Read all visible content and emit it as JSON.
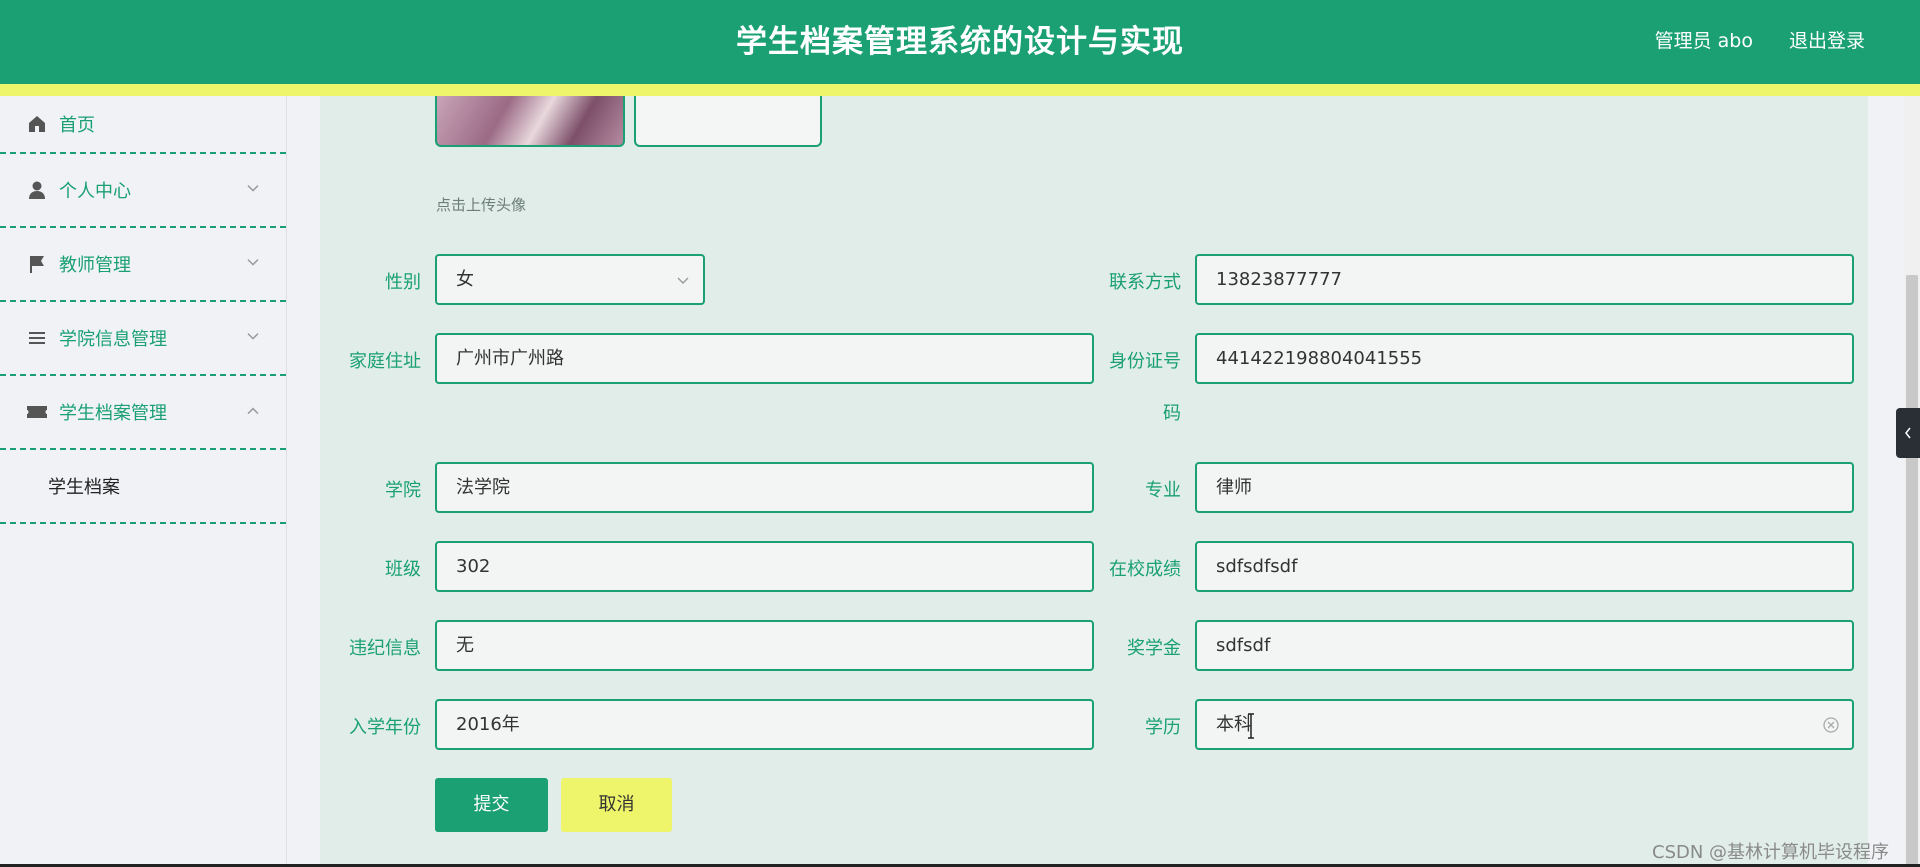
{
  "header": {
    "title": "学生档案管理系统的设计与实现",
    "user_label": "管理员 abo",
    "logout_label": "退出登录"
  },
  "sidebar": {
    "items": [
      {
        "label": "首页",
        "icon": "home-icon"
      },
      {
        "label": "个人中心",
        "icon": "user-icon",
        "arrow": "chevron-down"
      },
      {
        "label": "教师管理",
        "icon": "flag-icon",
        "arrow": "chevron-down"
      },
      {
        "label": "学院信息管理",
        "icon": "list-icon",
        "arrow": "chevron-down"
      },
      {
        "label": "学生档案管理",
        "icon": "ticket-icon",
        "arrow": "chevron-up"
      }
    ],
    "submenu": {
      "label": "学生档案"
    }
  },
  "form": {
    "upload_hint": "点击上传头像",
    "gender": {
      "label": "性别",
      "value": "女"
    },
    "contact": {
      "label": "联系方式",
      "value": "13823877777"
    },
    "address": {
      "label": "家庭住址",
      "value": "广州市广州路"
    },
    "id_number": {
      "label_line1": "身份证号",
      "label_line2": "码",
      "value": "441422198804041555"
    },
    "college": {
      "label": "学院",
      "value": "法学院"
    },
    "major": {
      "label": "专业",
      "value": "律师"
    },
    "class": {
      "label": "班级",
      "value": "302"
    },
    "grades": {
      "label": "在校成绩",
      "value": "sdfsdfsdf"
    },
    "discipline": {
      "label": "违纪信息",
      "value": "无"
    },
    "scholarship": {
      "label": "奖学金",
      "value": "sdfsdf"
    },
    "enroll_year": {
      "label": "入学年份",
      "value": "2016年"
    },
    "education": {
      "label": "学历",
      "value": "本科"
    },
    "submit_label": "提交",
    "cancel_label": "取消"
  },
  "watermark": "CSDN @基林计算机毕设程序",
  "colors": {
    "primary": "#1aa073",
    "accent": "#eef56a",
    "content_bg": "#e0ede9"
  }
}
